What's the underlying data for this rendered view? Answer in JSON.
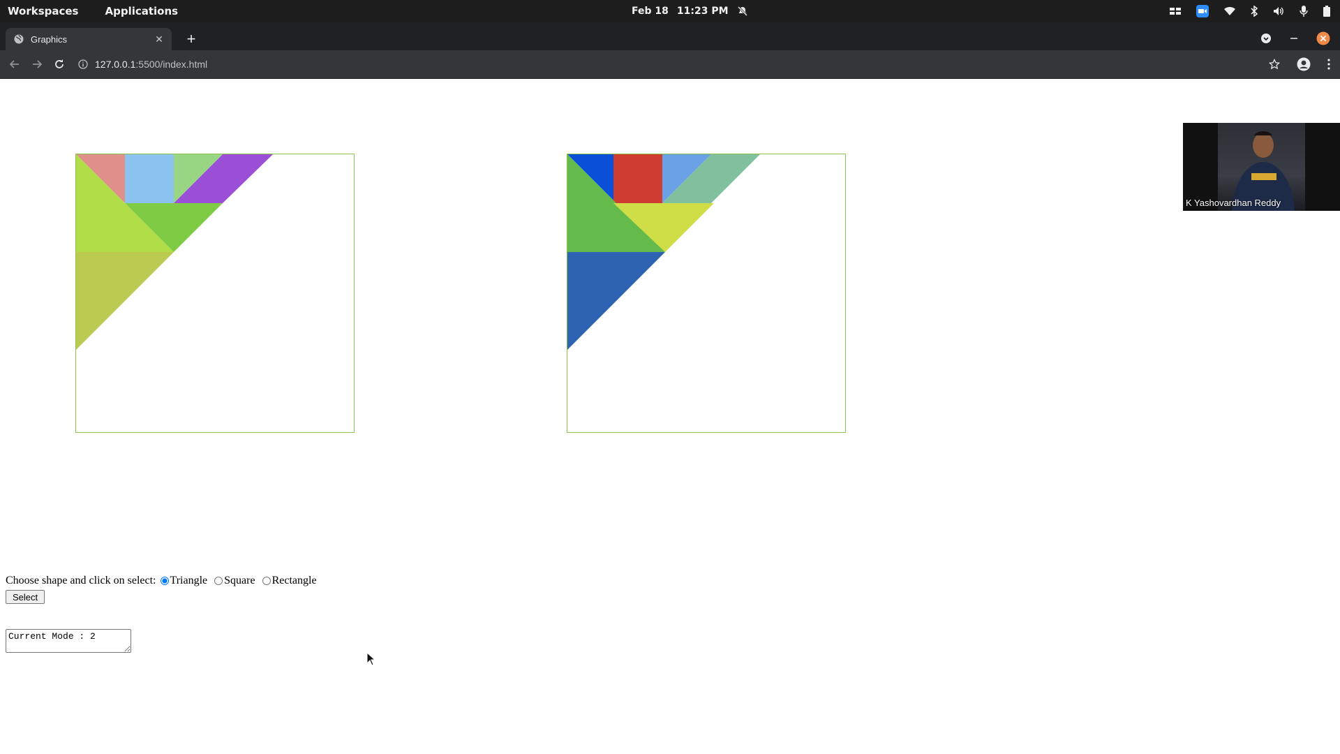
{
  "system_bar": {
    "workspaces": "Workspaces",
    "applications": "Applications",
    "date": "Feb 18",
    "time": "11:23 PM"
  },
  "browser": {
    "tab_title": "Graphics",
    "url_host": "127.0.0.1",
    "url_path": ":5500/index.html"
  },
  "page": {
    "shape_prompt": "Choose shape and click on select:",
    "shape_options": [
      "Triangle",
      "Square",
      "Rectangle"
    ],
    "selected_shape": "Triangle",
    "select_button": "Select",
    "mode_text": "Current Mode : 2"
  },
  "video": {
    "participant_name": "K Yashovardhan Reddy"
  },
  "colors": {
    "canvas_border": "#8bc34a",
    "canvas1_pieces": [
      "#e0908a",
      "#8cc2ef",
      "#98d683",
      "#9b4fd6",
      "#b1dd49",
      "#7fcb44",
      "#bcca52"
    ],
    "canvas2_pieces": [
      "#0b50d8",
      "#cf3c32",
      "#6ba2e6",
      "#80c09e",
      "#64bb4b",
      "#cfdd47",
      "#2d63b0"
    ]
  }
}
